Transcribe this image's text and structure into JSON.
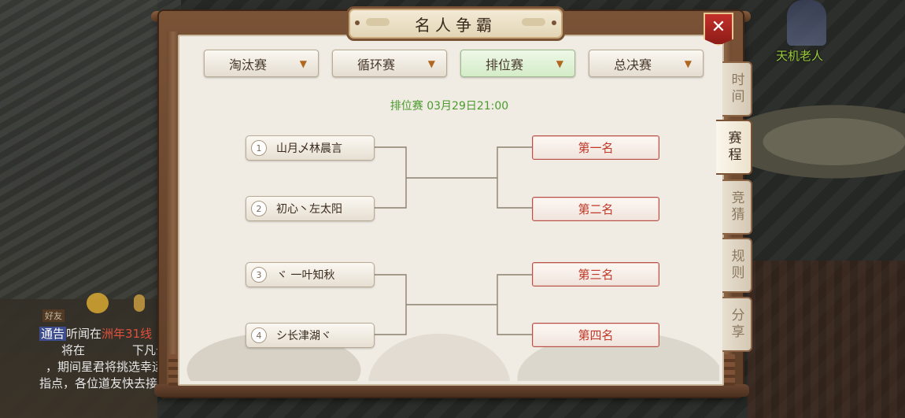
{
  "panel": {
    "title": "名人争霸",
    "close_glyph": "✕"
  },
  "tabs": [
    {
      "label": "淘汰赛",
      "arrow": "▼",
      "active": false
    },
    {
      "label": "循环赛",
      "arrow": "▼",
      "active": false
    },
    {
      "label": "排位赛",
      "arrow": "▼",
      "active": true
    },
    {
      "label": "总决赛",
      "arrow": "▼",
      "active": false
    }
  ],
  "match_info": "排位赛 03月29日21:00",
  "players": [
    {
      "num": "1",
      "name": "山月乄林晨言"
    },
    {
      "num": "2",
      "name": "初心丶左太阳"
    },
    {
      "num": "3",
      "name": "ヾ 一叶知秋"
    },
    {
      "num": "4",
      "name": "シ长津湖ヾ"
    }
  ],
  "ranks": [
    "第一名",
    "第二名",
    "第三名",
    "第四名"
  ],
  "side_tabs": [
    {
      "label": "时间",
      "active": false
    },
    {
      "label": "赛程",
      "active": true
    },
    {
      "label": "竞猜",
      "active": false
    },
    {
      "label": "规则",
      "active": false
    },
    {
      "label": "分享",
      "active": false
    }
  ],
  "background": {
    "npc_name": "天机老人",
    "chat_friend_label": "好友",
    "chat_lines": [
      {
        "tag": "通告",
        "text": "听闻在",
        "red": "洲年31线"
      },
      {
        "tag": "",
        "text": "将在",
        "red": "",
        "tail": "下凡云"
      },
      {
        "tag": "",
        "text": "，期间星君将挑选幸运",
        "red": ""
      },
      {
        "tag": "",
        "text": "指点，各位道友快去接",
        "red": ""
      }
    ]
  },
  "colors": {
    "accent_green": "#4a9a2c",
    "rank_red": "#c03828",
    "frame_brown": "#7a5236"
  }
}
